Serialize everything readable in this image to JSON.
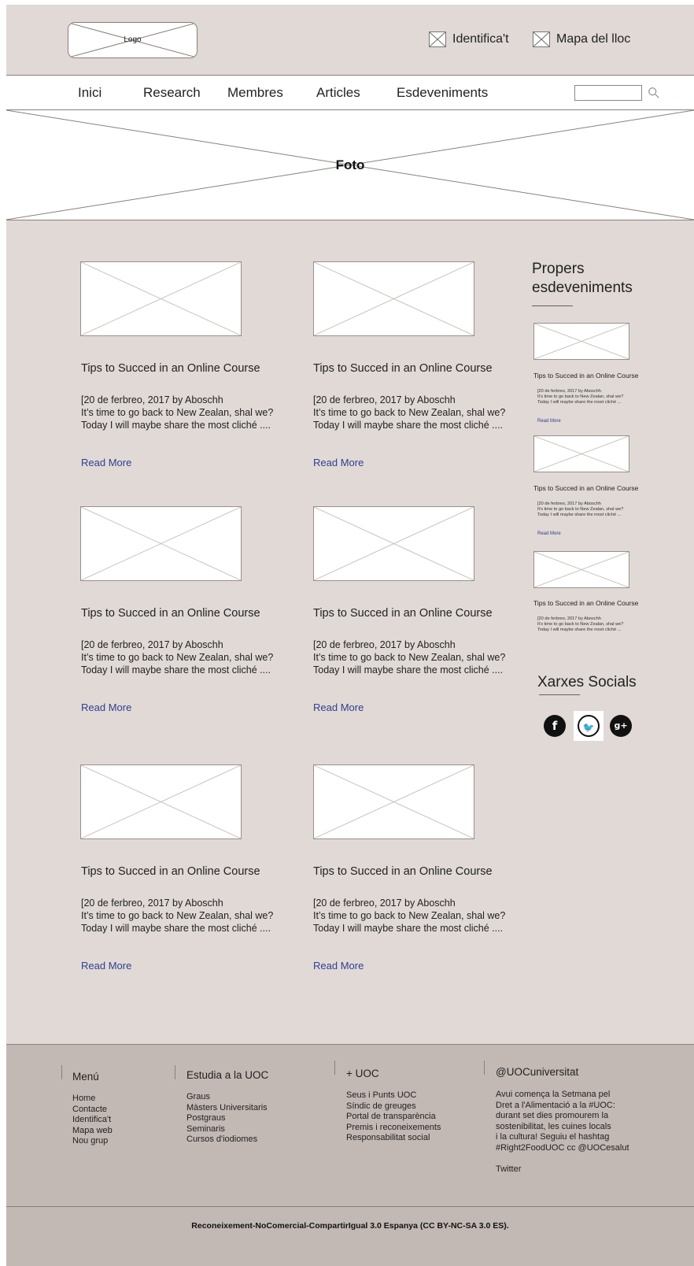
{
  "header": {
    "logo_label": "Logo",
    "login_label": "Identifica't",
    "sitemap_label": "Mapa del lloc"
  },
  "nav": {
    "items": [
      "Inici",
      "Research",
      "Membres",
      "Articles",
      "Esdeveniments"
    ],
    "search_placeholder": ""
  },
  "hero": {
    "label": "Foto"
  },
  "posts": [
    {
      "title": "Tips to Succed in an Online Course",
      "line1": "[20 de ferbreo, 2017 by Aboschh",
      "line2": "It’s time to go back to New Zealan, shal we?",
      "line3": "Today I will maybe share the most cliché ....",
      "more": "Read More"
    },
    {
      "title": "Tips to Succed in an Online Course",
      "line1": "[20 de ferbreo, 2017 by Aboschh",
      "line2": "It’s time to go back to New Zealan, shal we?",
      "line3": "Today I will maybe share the most cliché ....",
      "more": "Read More"
    },
    {
      "title": "Tips to Succed in an Online Course",
      "line1": "[20 de ferbreo, 2017 by Aboschh",
      "line2": "It’s time to go back to New Zealan, shal we?",
      "line3": "Today I will maybe share the most cliché ....",
      "more": "Read More"
    },
    {
      "title": "Tips to Succed in an Online Course",
      "line1": "[20 de ferbreo, 2017 by Aboschh",
      "line2": "It’s time to go back to New Zealan, shal we?",
      "line3": "Today I will maybe share the most cliché ....",
      "more": "Read More"
    },
    {
      "title": "Tips to Succed in an Online Course",
      "line1": "[20 de ferbreo, 2017 by Aboschh",
      "line2": "It’s time to go back to New Zealan, shal we?",
      "line3": "Today I will maybe share the most cliché ....",
      "more": "Read More"
    },
    {
      "title": "Tips to Succed in an Online Course",
      "line1": "[20 de ferbreo, 2017 by Aboschh",
      "line2": "It’s time to go back to New Zealan, shal we?",
      "line3": "Today I will maybe share the most cliché ....",
      "more": "Read More"
    }
  ],
  "sidebar": {
    "events_title_1": "Propers",
    "events_title_2": "esdeveniments",
    "events": [
      {
        "title": "Tips to Succed in an Online Course",
        "line1": "[20 de ferbreo, 2017 by Aboschh",
        "line2": "It’s time to go back to New Zealan, shal we?",
        "line3": "Today I will maybe share the most cliché ...",
        "more": "Read More"
      },
      {
        "title": "Tips to Succed in an Online Course",
        "line1": "[20 de ferbreo, 2017 by Aboschh",
        "line2": "It’s time to go back to New Zealan, shal we?",
        "line3": "Today I will maybe share the most cliché ...",
        "more": "Read More"
      },
      {
        "title": "Tips to Succed in an Online Course",
        "line1": "[20 de ferbreo, 2017 by Aboschh",
        "line2": "It’s time to go back to New Zealan, shal we?",
        "line3": "Today I will maybe share the most cliché ...",
        "more": ""
      }
    ],
    "social_title": "Xarxes Socials",
    "social_icons": [
      "facebook-icon",
      "twitter-icon",
      "google-plus-icon"
    ],
    "facebook_glyph": "f",
    "twitter_glyph": "🐦",
    "gplus_glyph": "g+"
  },
  "footer": {
    "menu_title": "Menú",
    "menu_items": [
      "Home",
      "Contacte",
      "Identifica't",
      "Mapa web",
      "Nou grup"
    ],
    "study_title": "Estudia a la UOC",
    "study_items": [
      "Graus",
      "Màsters Universitaris",
      "Postgraus",
      "Seminaris",
      "Cursos d'iodiomes"
    ],
    "uoc_title": "+ UOC",
    "uoc_items": [
      "Seus i Punts UOC",
      "Síndic de greuges",
      "Portal de transparència",
      "Premis i reconeixements",
      "Responsabilitat social"
    ],
    "twitter_title": "@UOCuniversitat",
    "tweet_lines": [
      "Avui comença la Setmana pel",
      "Dret a l'Alimentació a la #UOC:",
      "durant set dies promourem la",
      "sostenibilitat, les cuines locals",
      "i la cultura! Seguiu el hashtag",
      "#Right2FoodUOC cc @UOCesalut"
    ],
    "twitter_link": "Twitter"
  },
  "license": "Reconeixement-NoComercial-CompartirIgual 3.0 Espanya (CC BY-NC-SA 3.0 ES)."
}
